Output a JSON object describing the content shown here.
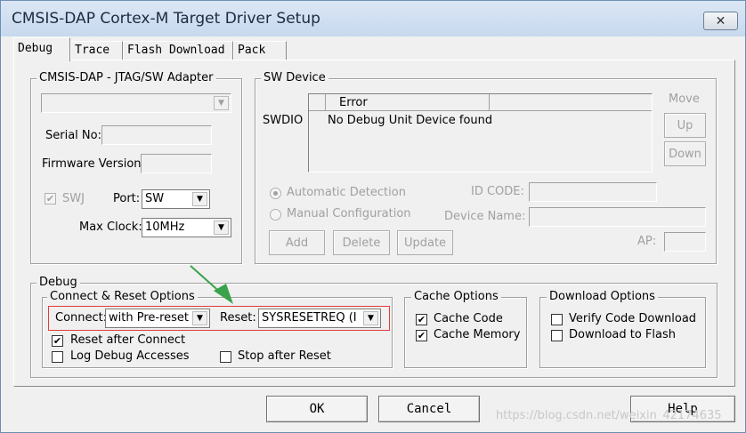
{
  "window": {
    "title": "CMSIS-DAP Cortex-M Target Driver Setup",
    "close_glyph": "✕"
  },
  "tabs": [
    "Debug",
    "Trace",
    "Flash Download",
    "Pack"
  ],
  "adapter": {
    "group_label": "CMSIS-DAP - JTAG/SW Adapter",
    "adapter_value": "",
    "serial_label": "Serial No:",
    "serial_value": "",
    "firmware_label": "Firmware Version:",
    "firmware_value": "",
    "swj_label": "SWJ",
    "swj_checked": "✔",
    "port_label": "Port:",
    "port_value": "SW",
    "clock_label": "Max Clock:",
    "clock_value": "10MHz"
  },
  "sw_device": {
    "group_label": "SW Device",
    "swdio_label": "SWDIO",
    "col_error": "Error",
    "col2": "",
    "row_text": "No Debug Unit Device found",
    "move_label": "Move",
    "up_label": "Up",
    "down_label": "Down",
    "auto_detect_label": "Automatic Detection",
    "manual_config_label": "Manual Configuration",
    "id_code_label": "ID CODE:",
    "device_name_label": "Device Name:",
    "ap_label": "AP:",
    "add_label": "Add",
    "delete_label": "Delete",
    "update_label": "Update"
  },
  "debug": {
    "group_label": "Debug",
    "connect_reset_label": "Connect & Reset Options",
    "connect_label": "Connect:",
    "connect_value": "with Pre-reset",
    "reset_label": "Reset:",
    "reset_value": "SYSRESETREQ (I",
    "reset_after_connect_label": "Reset after Connect",
    "reset_after_connect_checked": "✔",
    "log_debug_label": "Log Debug Accesses",
    "stop_after_reset_label": "Stop after Reset",
    "highlight_color": "#e23a3a",
    "arrow_color": "#3aa24a"
  },
  "cache": {
    "group_label": "Cache Options",
    "cache_code_label": "Cache Code",
    "cache_code_checked": "✔",
    "cache_memory_label": "Cache Memory",
    "cache_memory_checked": "✔"
  },
  "download": {
    "group_label": "Download Options",
    "verify_label": "Verify Code Download",
    "download_flash_label": "Download to Flash"
  },
  "buttons": {
    "ok": "OK",
    "cancel": "Cancel",
    "help": "Help"
  },
  "watermark": "https://blog.csdn.net/weixin_42174635",
  "dropdown_glyph": "▼"
}
